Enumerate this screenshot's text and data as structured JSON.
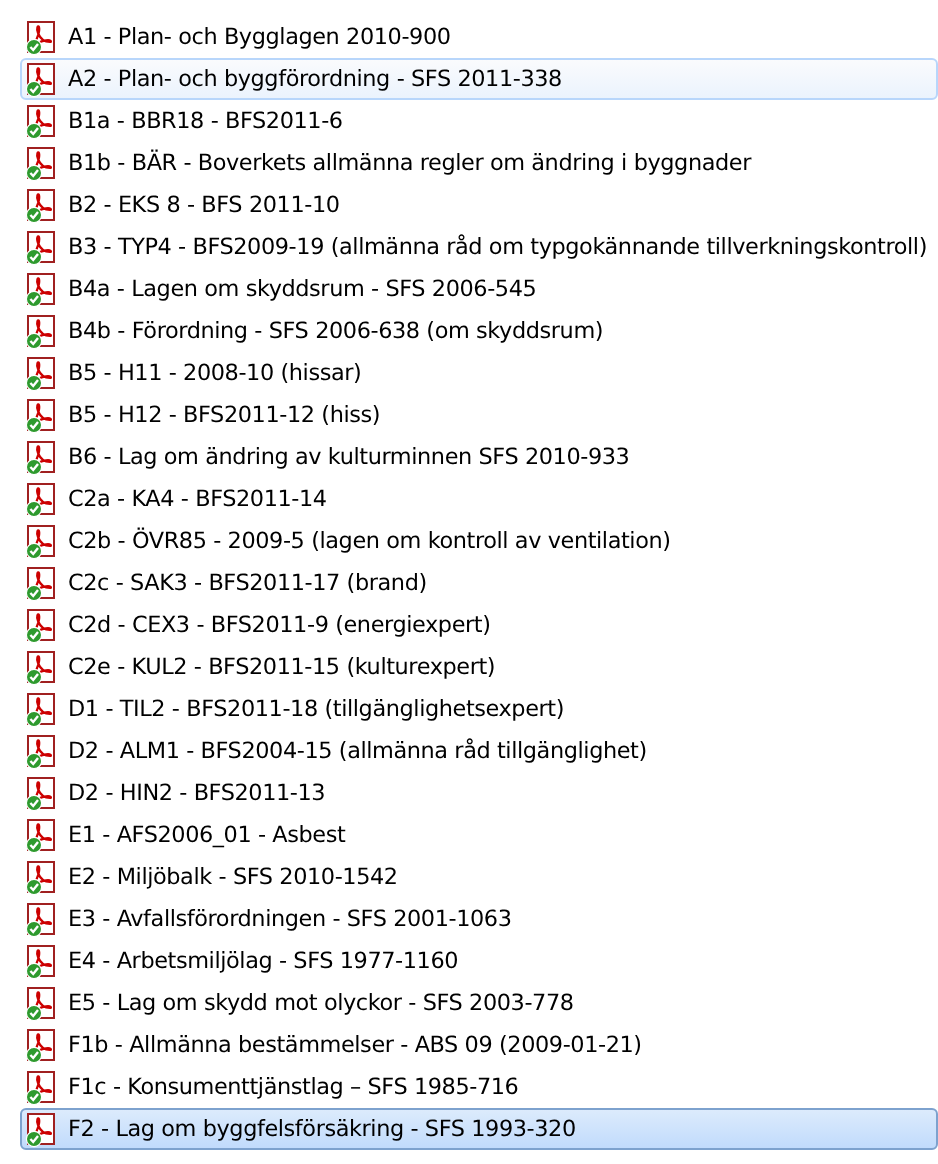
{
  "files": [
    {
      "name": "A1 - Plan- och Bygglagen 2010-900",
      "hovered": false,
      "selected": false
    },
    {
      "name": "A2 - Plan- och byggförordning - SFS 2011-338",
      "hovered": true,
      "selected": false
    },
    {
      "name": "B1a - BBR18 - BFS2011-6",
      "hovered": false,
      "selected": false
    },
    {
      "name": "B1b - BÄR - Boverkets allmänna regler om ändring i byggnader",
      "hovered": false,
      "selected": false
    },
    {
      "name": "B2 - EKS 8 - BFS 2011-10",
      "hovered": false,
      "selected": false
    },
    {
      "name": "B3 - TYP4 - BFS2009-19 (allmänna råd om typgokännande tillverkningskontroll)",
      "hovered": false,
      "selected": false
    },
    {
      "name": "B4a - Lagen om skyddsrum - SFS 2006-545",
      "hovered": false,
      "selected": false
    },
    {
      "name": "B4b - Förordning - SFS 2006-638 (om skyddsrum)",
      "hovered": false,
      "selected": false
    },
    {
      "name": "B5 - H11 - 2008-10 (hissar)",
      "hovered": false,
      "selected": false
    },
    {
      "name": "B5 - H12 - BFS2011-12 (hiss)",
      "hovered": false,
      "selected": false
    },
    {
      "name": "B6 - Lag om ändring av kulturminnen SFS 2010-933",
      "hovered": false,
      "selected": false
    },
    {
      "name": "C2a - KA4 - BFS2011-14",
      "hovered": false,
      "selected": false
    },
    {
      "name": "C2b - ÖVR85 - 2009-5 (lagen om kontroll av ventilation)",
      "hovered": false,
      "selected": false
    },
    {
      "name": "C2c - SAK3 - BFS2011-17 (brand)",
      "hovered": false,
      "selected": false
    },
    {
      "name": "C2d - CEX3 - BFS2011-9 (energiexpert)",
      "hovered": false,
      "selected": false
    },
    {
      "name": "C2e - KUL2 - BFS2011-15 (kulturexpert)",
      "hovered": false,
      "selected": false
    },
    {
      "name": "D1 - TIL2 - BFS2011-18 (tillgänglighetsexpert)",
      "hovered": false,
      "selected": false
    },
    {
      "name": "D2 - ALM1 - BFS2004-15 (allmänna råd tillgänglighet)",
      "hovered": false,
      "selected": false
    },
    {
      "name": "D2 - HIN2 - BFS2011-13",
      "hovered": false,
      "selected": false
    },
    {
      "name": "E1 - AFS2006_01 - Asbest",
      "hovered": false,
      "selected": false
    },
    {
      "name": "E2 - Miljöbalk - SFS 2010-1542",
      "hovered": false,
      "selected": false
    },
    {
      "name": "E3 - Avfallsförordningen - SFS 2001-1063",
      "hovered": false,
      "selected": false
    },
    {
      "name": "E4 - Arbetsmiljölag - SFS 1977-1160",
      "hovered": false,
      "selected": false
    },
    {
      "name": "E5 - Lag om skydd mot olyckor - SFS 2003-778",
      "hovered": false,
      "selected": false
    },
    {
      "name": "F1b - Allmänna bestämmelser - ABS 09 (2009-01-21)",
      "hovered": false,
      "selected": false
    },
    {
      "name": "F1c - Konsumenttjänstlag – SFS 1985-716",
      "hovered": false,
      "selected": false
    },
    {
      "name": "F2 - Lag om byggfelsförsäkring - SFS 1993-320",
      "hovered": false,
      "selected": true
    }
  ]
}
